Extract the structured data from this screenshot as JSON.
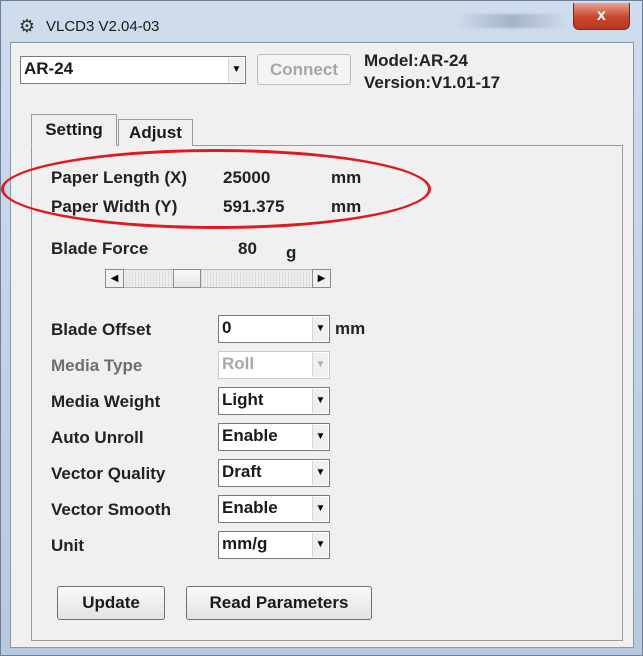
{
  "window": {
    "title": "VLCD3 V2.04-03",
    "close_symbol": "x"
  },
  "top": {
    "model_select_value": "AR-24",
    "connect_label": "Connect",
    "model_info": "Model:AR-24",
    "version_info": "Version:V1.01-17"
  },
  "tabs": [
    {
      "label": "Setting",
      "active": true
    },
    {
      "label": "Adjust",
      "active": false
    }
  ],
  "paper": {
    "length_label": "Paper Length (X)",
    "length_value": "25000",
    "length_unit": "mm",
    "width_label": "Paper Width (Y)",
    "width_value": "591.375",
    "width_unit": "mm"
  },
  "blade_force": {
    "label": "Blade Force",
    "value": "80",
    "unit": "g",
    "slider_level": 0.3
  },
  "settings": [
    {
      "label": "Blade Offset",
      "value": "0",
      "enabled": true
    },
    {
      "label": "Media Type",
      "value": "Roll",
      "enabled": false
    },
    {
      "label": "Media Weight",
      "value": "Light",
      "enabled": true
    },
    {
      "label": "Auto Unroll",
      "value": "Enable",
      "enabled": true
    },
    {
      "label": "Vector Quality",
      "value": "Draft",
      "enabled": true
    },
    {
      "label": "Vector Smooth",
      "value": "Enable",
      "enabled": true
    },
    {
      "label": "Unit",
      "value": "mm/g",
      "enabled": true
    }
  ],
  "blade_offset_unit": "mm",
  "buttons": {
    "update": "Update",
    "read_parameters": "Read Parameters"
  },
  "colors": {
    "highlight": "#e0181f",
    "close_button": "#c8452c"
  }
}
